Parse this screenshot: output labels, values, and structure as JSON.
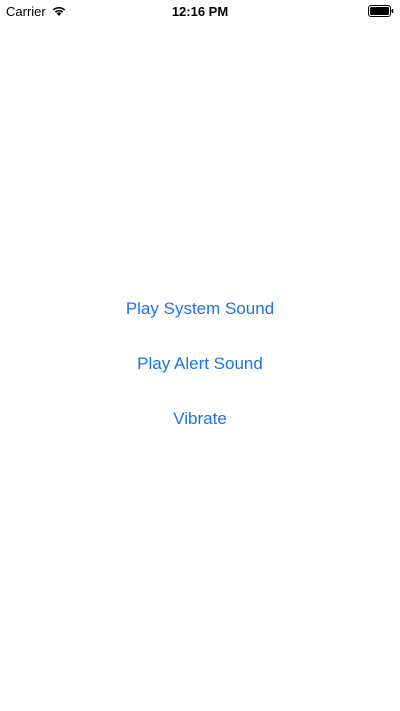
{
  "status_bar": {
    "carrier": "Carrier",
    "time": "12:16 PM",
    "wifi_icon": "wifi-icon",
    "battery_icon": "battery-icon"
  },
  "main": {
    "buttons": [
      {
        "label": "Play System Sound"
      },
      {
        "label": "Play Alert Sound"
      },
      {
        "label": "Vibrate"
      }
    ]
  },
  "colors": {
    "accent": "#1a73e8",
    "text": "#000000",
    "background": "#ffffff"
  }
}
